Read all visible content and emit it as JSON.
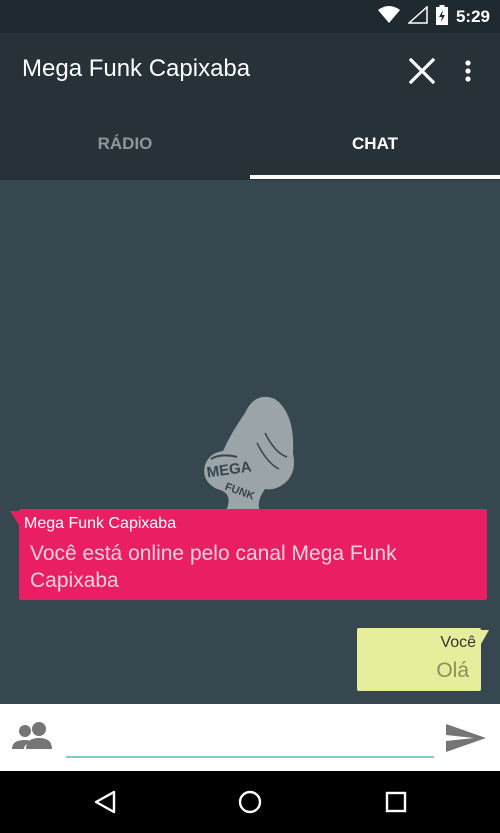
{
  "status_bar": {
    "time": "5:29"
  },
  "app_bar": {
    "title": "Mega Funk Capixaba"
  },
  "tabs": [
    {
      "label": "RÁDIO",
      "selected": false
    },
    {
      "label": "CHAT",
      "selected": true
    }
  ],
  "chat": {
    "messages": [
      {
        "sender": "Mega Funk Capixaba",
        "text": "Você está online pelo canal Mega Funk Capixaba",
        "direction": "incoming",
        "color": "#e91e63"
      },
      {
        "sender": "Você",
        "text": "Olá",
        "direction": "outgoing",
        "color": "#e6ee9c"
      }
    ]
  },
  "input_bar": {
    "value": "",
    "placeholder": ""
  },
  "colors": {
    "toolbar": "#263238",
    "chat_background": "#37474f",
    "accent": "#80cbc4"
  },
  "icons": [
    "wifi-icon",
    "signal-icon",
    "battery-icon",
    "close-icon",
    "more-vert-icon",
    "users-icon",
    "send-icon",
    "back-icon",
    "home-icon",
    "recents-icon"
  ]
}
